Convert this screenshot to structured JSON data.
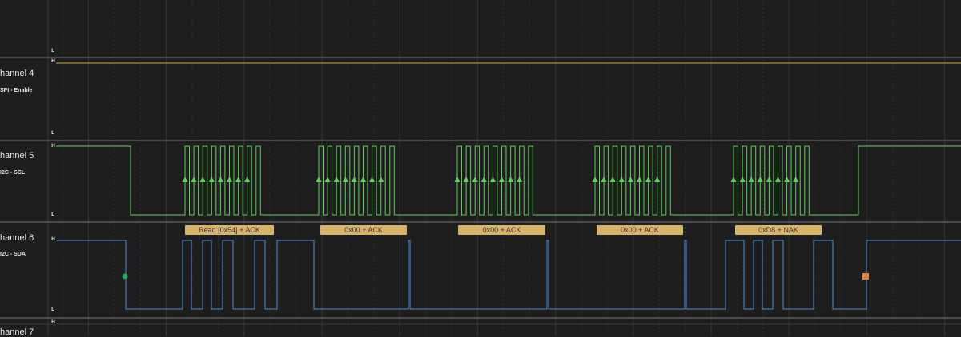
{
  "channels": [
    {
      "id": "ch3",
      "name": "",
      "protocol": "",
      "high": "",
      "low": "L"
    },
    {
      "id": "ch4",
      "name": "hannel 4",
      "protocol": "SPI - Enable",
      "high": "H",
      "low": "L"
    },
    {
      "id": "ch5",
      "name": "hannel 5",
      "protocol": "I2C - SCL",
      "high": "H",
      "low": "L"
    },
    {
      "id": "ch6",
      "name": "hannel 6",
      "protocol": "I2C - SDA",
      "high": "H",
      "low": "L"
    },
    {
      "id": "ch7",
      "name": "hannel 7",
      "protocol": "",
      "high": "H",
      "low": ""
    }
  ],
  "frames": [
    {
      "label": "Read [0x54] + ACK"
    },
    {
      "label": "0x00 + ACK"
    },
    {
      "label": "0x00 + ACK"
    },
    {
      "label": "0x00 + ACK"
    },
    {
      "label": "0xD8 + NAK"
    }
  ],
  "markers": {
    "start_color": "#27a55a",
    "stop_color": "#e0853a",
    "start_name": "start-marker",
    "stop_name": "stop-marker"
  },
  "colors": {
    "background": "#1e1e1e",
    "ch4_trace": "#c9a93a",
    "scl_trace": "#5fce5a",
    "sda_trace": "#4a8fd4",
    "frame_fill": "#d6b56b",
    "separator": "#4a4a4a"
  }
}
